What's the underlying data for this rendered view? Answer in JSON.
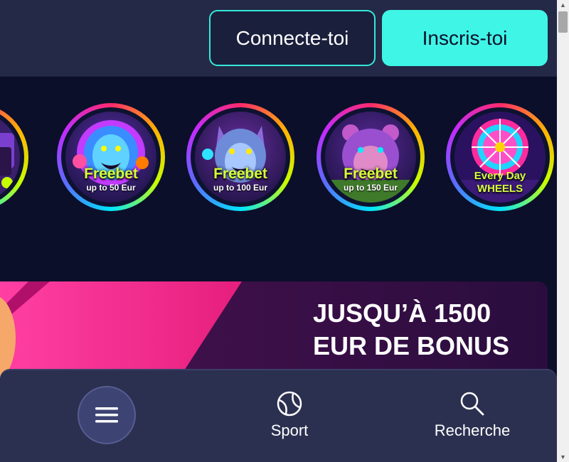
{
  "header": {
    "login_label": "Connecte-toi",
    "register_label": "Inscris-toi"
  },
  "promos": [
    {
      "title": "Freebet",
      "subtitle": "up to 50 Eur",
      "animal": "lion-icon"
    },
    {
      "title": "Freebet",
      "subtitle": "up to 100 Eur",
      "animal": "wolf-icon"
    },
    {
      "title": "Freebet",
      "subtitle": "up to 150 Eur",
      "animal": "bear-icon"
    },
    {
      "title_line1": "Every Day",
      "title_line2": "WHEELS",
      "animal": "wheel-icon"
    }
  ],
  "banner": {
    "line1": "JUSQU’À 1500",
    "line2": "EUR DE BONUS"
  },
  "bottom_nav": {
    "menu_icon": "hamburger-icon",
    "sport_label": "Sport",
    "search_label": "Recherche"
  },
  "colors": {
    "accent": "#3ff5e6",
    "header_bg": "#232946",
    "page_bg": "#0b0f2a",
    "nav_bg": "#2c3050",
    "promo_text": "#d6ff3a"
  }
}
